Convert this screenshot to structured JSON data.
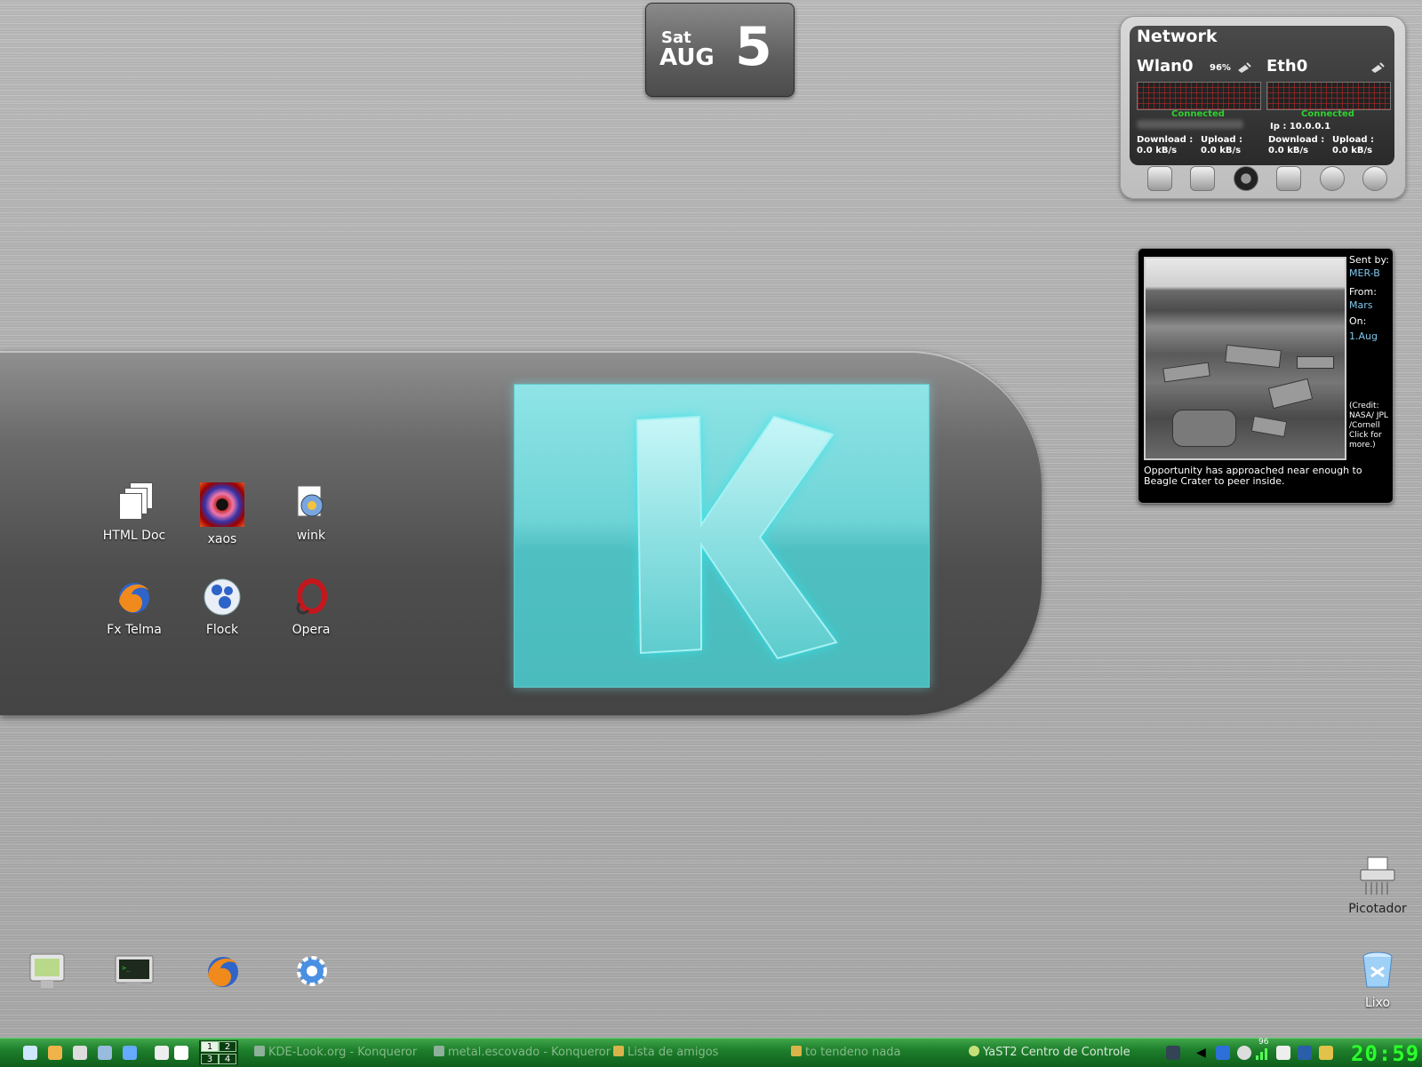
{
  "date_widget": {
    "weekday": "Sat",
    "month": "AUG",
    "day": "5"
  },
  "network_widget": {
    "title": "Network",
    "interfaces": [
      {
        "name": "Wlan0",
        "signal": "96%",
        "status": "Connected",
        "ip": "",
        "download_label": "Download :",
        "download_value": "0.0 kB/s",
        "upload_label": "Upload :",
        "upload_value": "0.0 kB/s"
      },
      {
        "name": "Eth0",
        "signal": "",
        "status": "Connected",
        "ip": "Ip : 10.0.0.1",
        "download_label": "Download :",
        "download_value": "0.0 kB/s",
        "upload_label": "Upload :",
        "upload_value": "0.0 kB/s"
      }
    ],
    "tab_icons": [
      "cpu-icon",
      "hard-disk-icon",
      "network-icon",
      "memory-icon",
      "alarm-clock-icon",
      "cd-drive-icon"
    ],
    "status_color": "#2fd12f"
  },
  "mars_widget": {
    "sent_by_label": "Sent by:",
    "sent_by": "MER-B",
    "from_label": "From:",
    "from": "Mars",
    "on_label": "On:",
    "on": "1.Aug",
    "credit": "(Credit: NASA/ JPL /Cornell Click for more.)",
    "caption": "Opportunity has approached near enough to Beagle Crater to peer inside."
  },
  "banner": {
    "letter": "K",
    "accent": "#6fd4d6"
  },
  "desktop_icons": [
    {
      "label": "HTML Doc",
      "icon": "documents-icon"
    },
    {
      "label": "xaos",
      "icon": "fractal-icon"
    },
    {
      "label": "wink",
      "icon": "wink-icon"
    },
    {
      "label": "Fx Telma",
      "icon": "firefox-icon"
    },
    {
      "label": "Flock",
      "icon": "flock-icon"
    },
    {
      "label": "Opera",
      "icon": "opera-icon"
    },
    {
      "label": "Picotador",
      "icon": "shredder-icon"
    },
    {
      "label": "Lixo",
      "icon": "trash-icon"
    }
  ],
  "dock_icons": [
    "monitor-icon",
    "terminal-icon",
    "firefox-icon",
    "konqueror-icon"
  ],
  "taskbar": {
    "pager": [
      "1",
      "2",
      "3",
      "4"
    ],
    "tasks": [
      "KDE-Look.org - Konqueror",
      "metal.escovado - Konqueror",
      "Lista de amigos",
      "to tendeno nada",
      "YaST2 Centro de Controle"
    ],
    "tray_badge": "96",
    "clock": "20:59",
    "clock_color": "#2bff2b"
  }
}
